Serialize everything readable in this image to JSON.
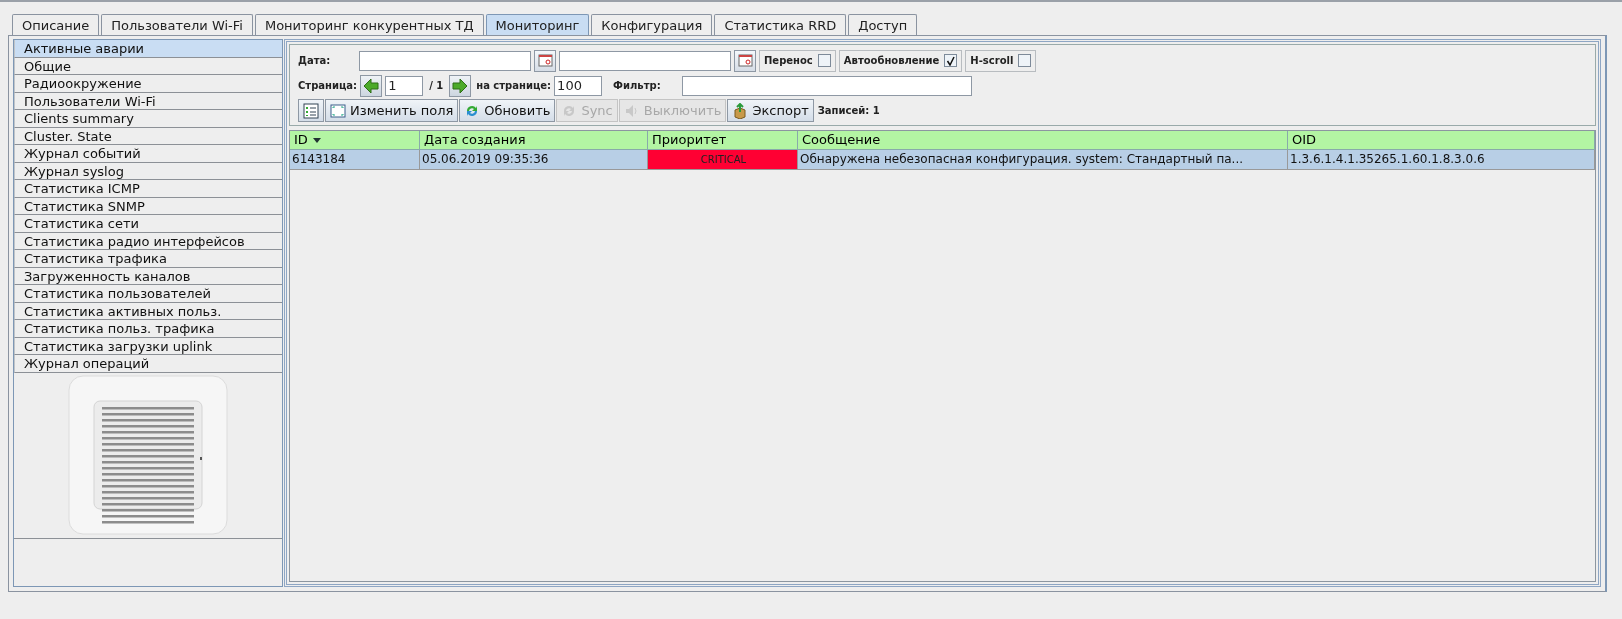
{
  "tabs": [
    {
      "label": "Описание",
      "selected": false
    },
    {
      "label": "Пользователи Wi-Fi",
      "selected": false
    },
    {
      "label": "Мониторинг конкурентных ТД",
      "selected": false
    },
    {
      "label": "Мониторинг",
      "selected": true
    },
    {
      "label": "Конфигурация",
      "selected": false
    },
    {
      "label": "Статистика RRD",
      "selected": false
    },
    {
      "label": "Доступ",
      "selected": false
    }
  ],
  "sidebar": {
    "items": [
      {
        "label": "Активные аварии",
        "selected": true
      },
      {
        "label": "Общие",
        "selected": false
      },
      {
        "label": "Радиоокружение",
        "selected": false
      },
      {
        "label": "Пользователи Wi-Fi",
        "selected": false
      },
      {
        "label": "Clients summary",
        "selected": false
      },
      {
        "label": "Cluster. State",
        "selected": false
      },
      {
        "label": "Журнал событий",
        "selected": false
      },
      {
        "label": "Журнал syslog",
        "selected": false
      },
      {
        "label": "Статистика ICMP",
        "selected": false
      },
      {
        "label": "Статистика SNMP",
        "selected": false
      },
      {
        "label": "Статистика сети",
        "selected": false
      },
      {
        "label": "Статистика радио интерфейсов",
        "selected": false
      },
      {
        "label": "Статистика трафика",
        "selected": false
      },
      {
        "label": "Загруженность каналов",
        "selected": false
      },
      {
        "label": "Статистика пользователей",
        "selected": false
      },
      {
        "label": "Статистика активных польз.",
        "selected": false
      },
      {
        "label": "Статистика польз. трафика",
        "selected": false
      },
      {
        "label": "Статистика загрузки uplink",
        "selected": false
      },
      {
        "label": "Журнал операций",
        "selected": false
      }
    ]
  },
  "filters": {
    "date_label": "Дата:",
    "options": [
      {
        "label": "Перенос",
        "checked": false
      },
      {
        "label": "Автообновление",
        "checked": true
      },
      {
        "label": "H-scroll",
        "checked": false
      }
    ],
    "page_label": "Страница:",
    "page_value": "1",
    "page_total": "/ 1",
    "per_page_label": "на странице:",
    "per_page_value": "100",
    "filter_label": "Фильтр:"
  },
  "toolbar": {
    "buttons": [
      {
        "kind": "columns",
        "disabled": false
      },
      {
        "kind": "edit",
        "label": "Изменить поля",
        "disabled": false
      },
      {
        "kind": "refresh",
        "label": "Обновить",
        "disabled": false
      },
      {
        "kind": "sync",
        "label": "Sync",
        "disabled": true
      },
      {
        "kind": "mute",
        "label": "Выключить",
        "disabled": true
      },
      {
        "kind": "export",
        "label": "Экспорт",
        "disabled": false
      }
    ],
    "records": "Записей: 1"
  },
  "table": {
    "columns": [
      {
        "label": "ID",
        "sorted": true
      },
      {
        "label": "Дата создания",
        "sorted": false
      },
      {
        "label": "Приоритет",
        "sorted": false
      },
      {
        "label": "Сообщение",
        "sorted": false
      },
      {
        "label": "OID",
        "sorted": false
      }
    ],
    "rows": [
      {
        "selected": true,
        "color": "#ff0033",
        "cells": [
          "6143184",
          "05.06.2019 09:35:36",
          "CRITICAL",
          "Обнаружена небезопасная конфигурация. system: Стандартный па...",
          "1.3.6.1.4.1.35265.1.60.1.8.3.0.6"
        ]
      }
    ]
  }
}
